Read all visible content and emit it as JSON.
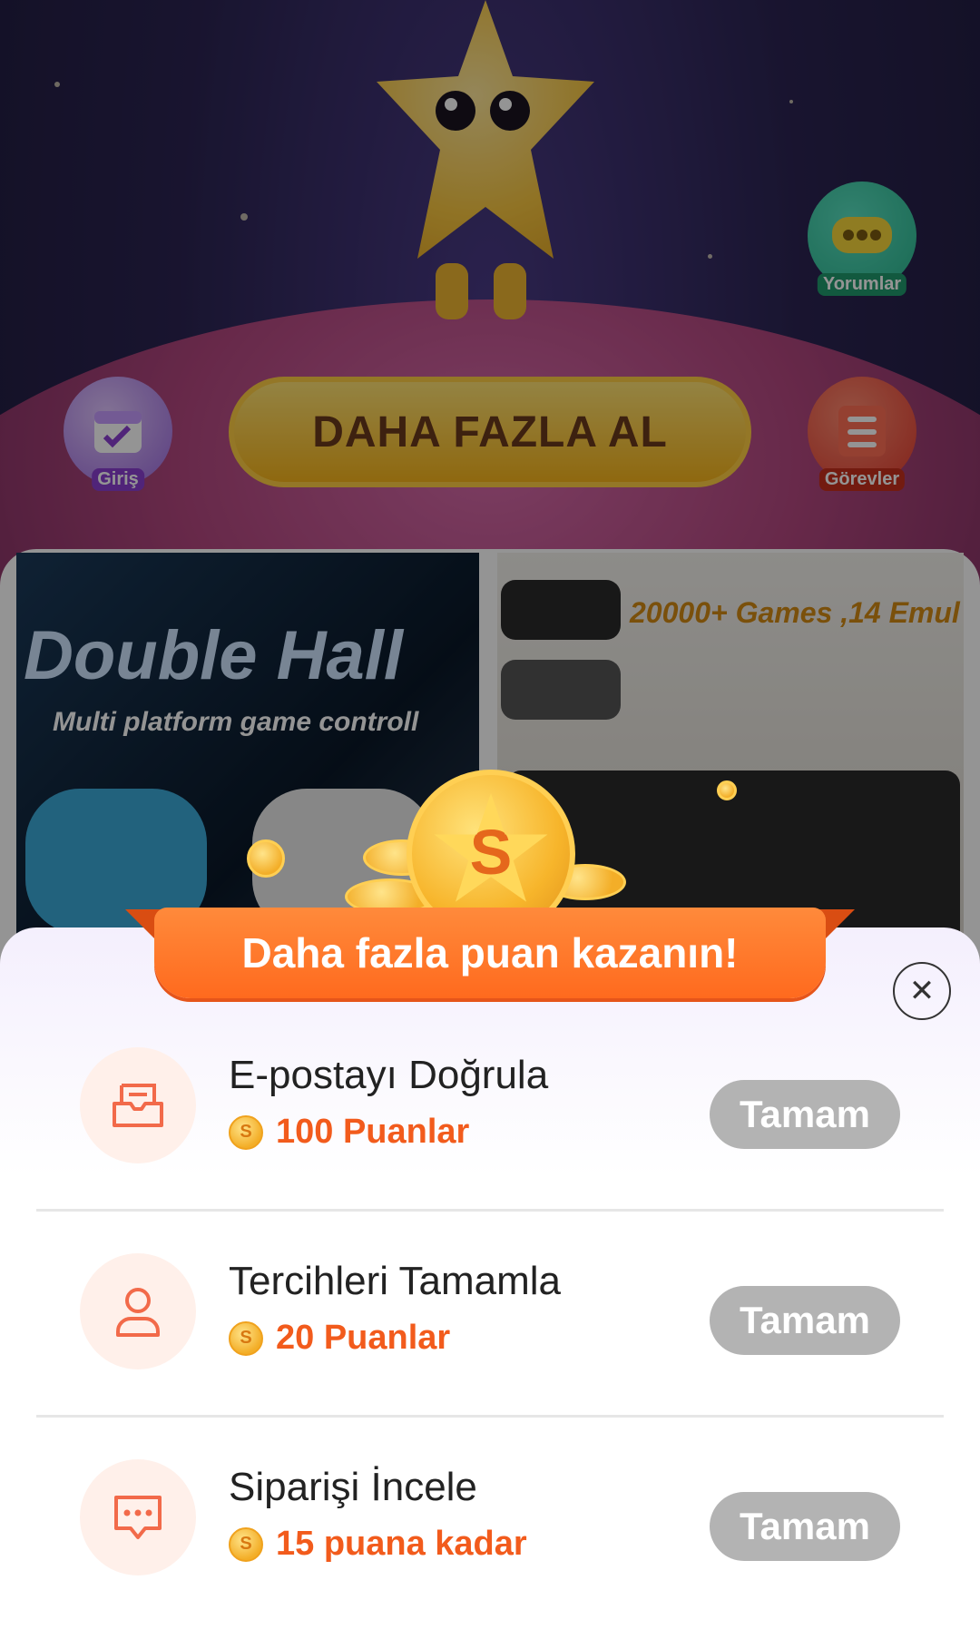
{
  "background": {
    "comments_label": "Yorumlar",
    "checkin_label": "Giriş",
    "tasks_label": "Görevler",
    "get_more_label": "DAHA FAZLA AL",
    "product1": {
      "title": "Double Hall",
      "subtitle": "Multi platform game controll"
    },
    "product2": {
      "title": "20000+ Games ,14 Emul"
    }
  },
  "sheet": {
    "title": "Daha fazla puan kazanın!",
    "close_icon": "close-icon",
    "tasks": [
      {
        "icon": "mail-icon",
        "title": "E-postayı Doğrula",
        "points": "100 Puanlar",
        "button": "Tamam"
      },
      {
        "icon": "user-icon",
        "title": "Tercihleri Tamamla",
        "points": "20 Puanlar",
        "button": "Tamam"
      },
      {
        "icon": "chat-icon",
        "title": "Siparişi İncele",
        "points": "15 puana kadar",
        "button": "Tamam"
      }
    ]
  },
  "colors": {
    "accent_orange": "#f25b1c",
    "button_disabled": "#b3b3b3",
    "banner": "#ff6a1e"
  }
}
